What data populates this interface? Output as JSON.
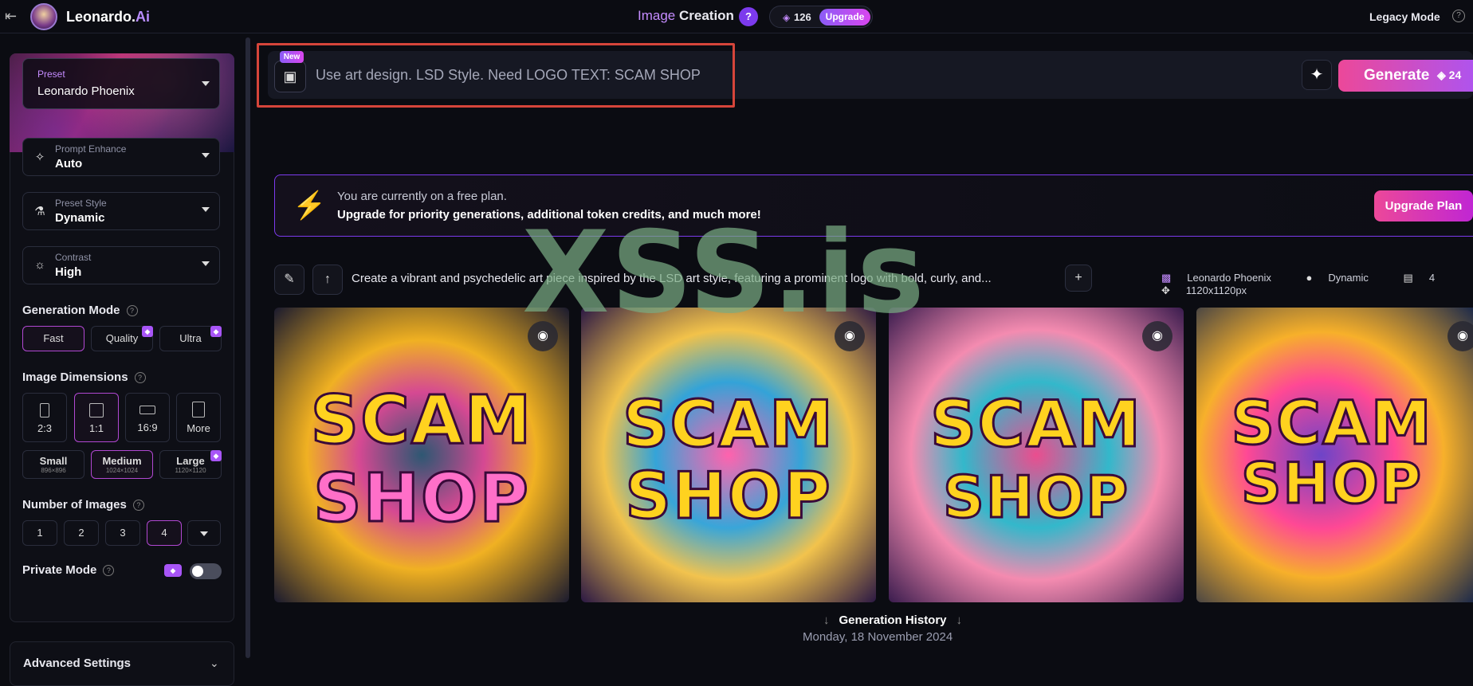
{
  "header": {
    "app_name": "Leonardo.",
    "app_suffix": "Ai",
    "title_prefix": "Image",
    "title_main": "Creation",
    "tokens": "126",
    "upgrade": "Upgrade",
    "legacy_mode": "Legacy Mode"
  },
  "sidebar": {
    "preset": {
      "label": "Preset",
      "value": "Leonardo Phoenix"
    },
    "prompt_enhance": {
      "label": "Prompt Enhance",
      "value": "Auto"
    },
    "preset_style": {
      "label": "Preset Style",
      "value": "Dynamic"
    },
    "contrast": {
      "label": "Contrast",
      "value": "High"
    },
    "generation_mode": {
      "label": "Generation Mode",
      "options": [
        "Fast",
        "Quality",
        "Ultra"
      ],
      "selected": "Fast"
    },
    "image_dimensions": {
      "label": "Image Dimensions",
      "ratios": [
        "2:3",
        "1:1",
        "16:9",
        "More"
      ],
      "selected_ratio": "1:1",
      "sizes": [
        {
          "name": "Small",
          "dims": "896×896"
        },
        {
          "name": "Medium",
          "dims": "1024×1024"
        },
        {
          "name": "Large",
          "dims": "1120×1120"
        }
      ],
      "selected_size": "Medium"
    },
    "number_of_images": {
      "label": "Number of Images",
      "options": [
        "1",
        "2",
        "3",
        "4"
      ],
      "selected": "4"
    },
    "private_mode": {
      "label": "Private Mode",
      "on": false
    },
    "advanced_settings": "Advanced Settings"
  },
  "prompt": {
    "new_badge": "New",
    "placeholder": "Use art design. LSD Style. Need LOGO TEXT: SCAM SHOP"
  },
  "generate": {
    "label": "Generate",
    "cost": "24"
  },
  "banner": {
    "line1": "You are currently on a free plan.",
    "line2": "Upgrade for priority generations, additional token credits, and much more!",
    "button": "Upgrade Plan"
  },
  "generation": {
    "prompt": "Create a vibrant and psychedelic art piece inspired by the LSD art style, featuring a prominent logo with bold, curly, and...",
    "model": "Leonardo Phoenix",
    "style": "Dynamic",
    "count": "4",
    "size": "1120x1120px",
    "images": [
      {
        "line1": "SCAM",
        "line2": "SHOP"
      },
      {
        "line1": "SCAM",
        "line2": "SHOP"
      },
      {
        "line1": "SCAM",
        "line2": "SHOP"
      },
      {
        "line1": "SCAM",
        "line2": "SHOP"
      }
    ]
  },
  "history": {
    "label": "Generation History",
    "date": "Monday, 18 November 2024"
  },
  "watermark": "XSS.is"
}
